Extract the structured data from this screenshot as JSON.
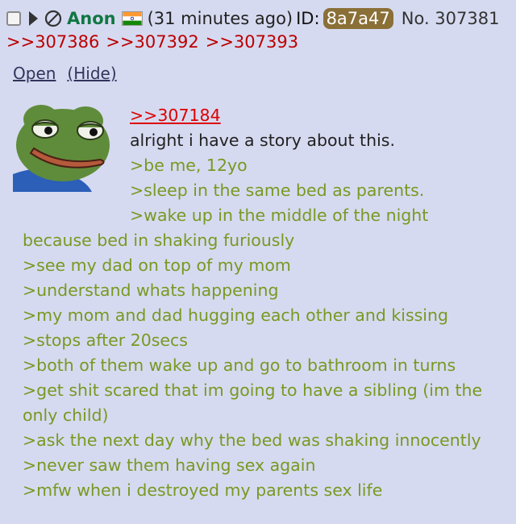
{
  "header": {
    "name": "Anon",
    "time": "(31 minutes ago)",
    "id_label": "ID:",
    "id_value": "8a7a47",
    "post_no": "No. 307381",
    "flag_icon": "india-flag-icon"
  },
  "replies": [
    ">>307386",
    ">>307392",
    ">>307393"
  ],
  "links": {
    "open": "Open",
    "hide": "(Hide)"
  },
  "thumbnail": {
    "icon": "pepe-frog-image"
  },
  "body": {
    "quote_link": ">>307184",
    "intro": "alright i have a story about this.",
    "lines": [
      ">be me, 12yo",
      ">sleep in the same bed as parents.",
      ">wake up in the middle of the night",
      "because bed in shaking furiously",
      ">see my dad on top of my mom",
      ">understand whats happening",
      ">my mom and dad hugging each other and kissing",
      ">stops after 20secs",
      ">both of them wake up and go to bathroom in turns",
      ">get shit scared that im going to have a sibling (im the",
      "only child)",
      ">ask the next day why the bed was shaking innocently",
      ">never saw them having sex again",
      ">mfw when i destroyed my parents sex life"
    ]
  },
  "colors": {
    "greentext": "#789922",
    "name": "#117743",
    "reply": "#bb0000",
    "background": "#d6daf0"
  }
}
